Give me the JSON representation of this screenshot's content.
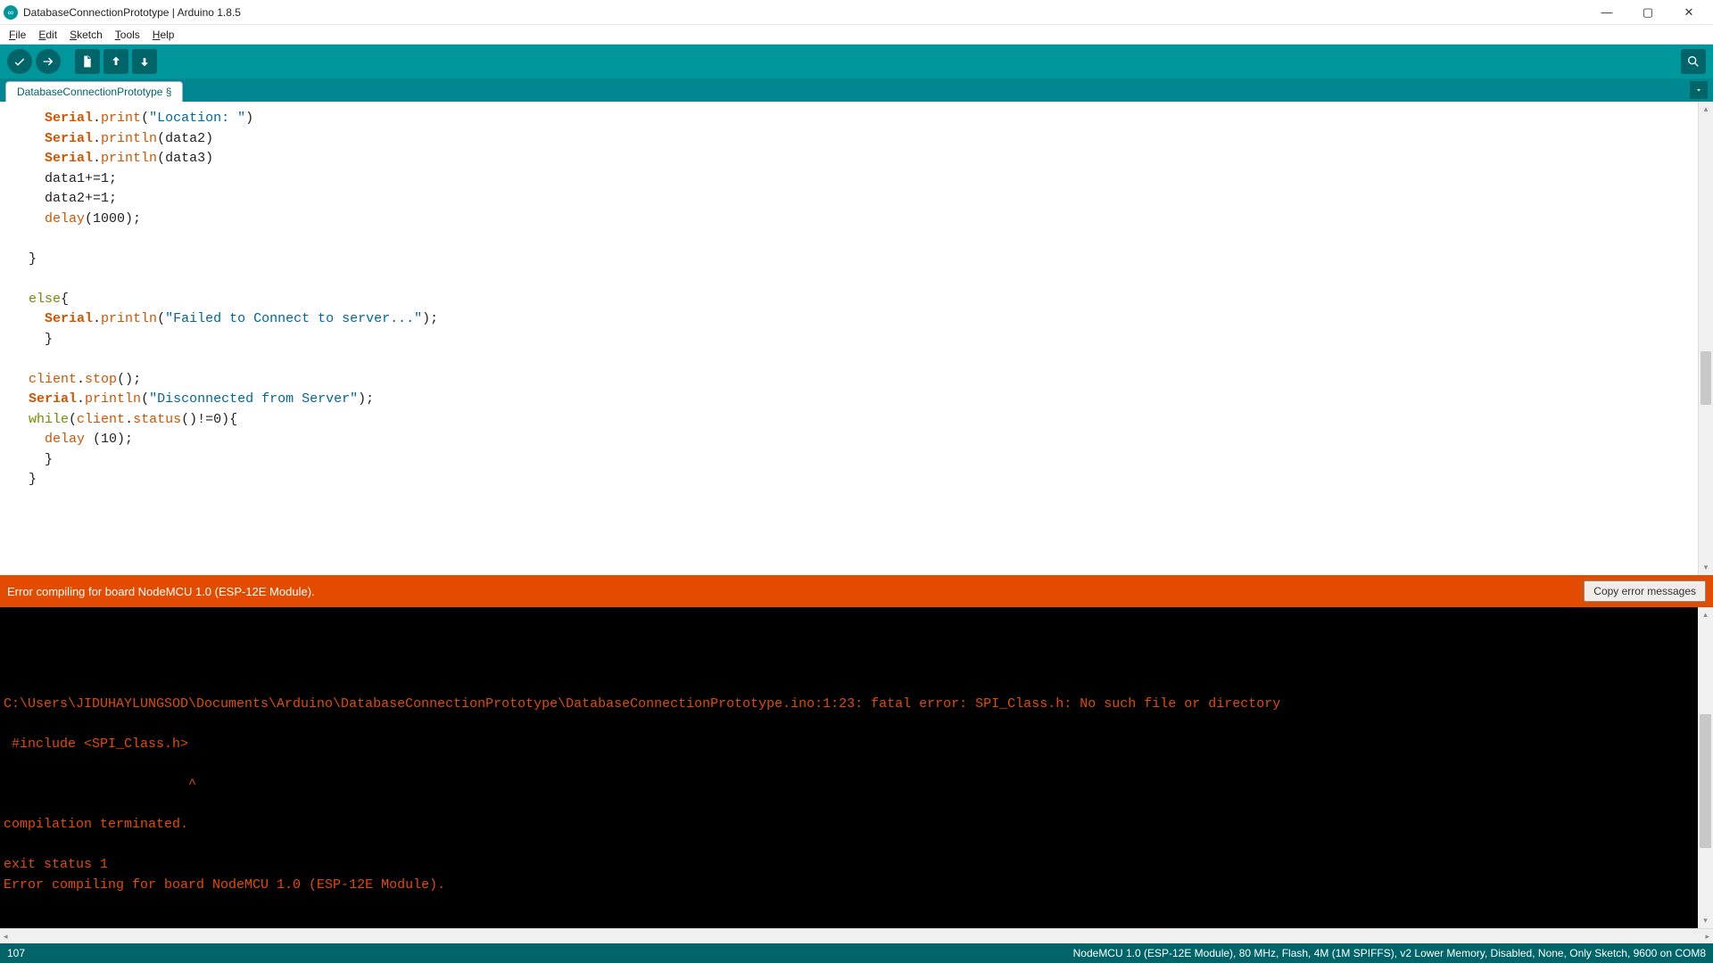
{
  "title": "DatabaseConnectionPrototype | Arduino 1.8.5",
  "app_icon_glyph": "∞",
  "menus": {
    "file": "File",
    "edit": "Edit",
    "sketch": "Sketch",
    "tools": "Tools",
    "help": "Help"
  },
  "tab": {
    "label": "DatabaseConnectionPrototype §"
  },
  "code_lines": [
    {
      "indent": 2,
      "tokens": [
        {
          "t": "Serial",
          "c": "kw-bold"
        },
        {
          "t": ".",
          "c": ""
        },
        {
          "t": "print",
          "c": "kw-orange"
        },
        {
          "t": "(",
          "c": ""
        },
        {
          "t": "\"Location: \"",
          "c": "str-blue"
        },
        {
          "t": ")",
          "c": ""
        }
      ]
    },
    {
      "indent": 2,
      "tokens": [
        {
          "t": "Serial",
          "c": "kw-bold"
        },
        {
          "t": ".",
          "c": ""
        },
        {
          "t": "println",
          "c": "kw-orange"
        },
        {
          "t": "(data2)",
          "c": ""
        }
      ]
    },
    {
      "indent": 2,
      "tokens": [
        {
          "t": "Serial",
          "c": "kw-bold"
        },
        {
          "t": ".",
          "c": ""
        },
        {
          "t": "println",
          "c": "kw-orange"
        },
        {
          "t": "(data3)",
          "c": ""
        }
      ]
    },
    {
      "indent": 2,
      "tokens": [
        {
          "t": "data1+=1;",
          "c": ""
        }
      ]
    },
    {
      "indent": 2,
      "tokens": [
        {
          "t": "data2+=1;",
          "c": ""
        }
      ]
    },
    {
      "indent": 2,
      "tokens": [
        {
          "t": "delay",
          "c": "kw-orange"
        },
        {
          "t": "(1000);",
          "c": ""
        }
      ]
    },
    {
      "indent": 0,
      "tokens": []
    },
    {
      "indent": 1,
      "tokens": [
        {
          "t": "}",
          "c": ""
        }
      ]
    },
    {
      "indent": 0,
      "tokens": []
    },
    {
      "indent": 1,
      "tokens": [
        {
          "t": "else",
          "c": "green"
        },
        {
          "t": "{",
          "c": ""
        }
      ]
    },
    {
      "indent": 2,
      "tokens": [
        {
          "t": "Serial",
          "c": "kw-bold"
        },
        {
          "t": ".",
          "c": ""
        },
        {
          "t": "println",
          "c": "kw-orange"
        },
        {
          "t": "(",
          "c": ""
        },
        {
          "t": "\"Failed to Connect to server...\"",
          "c": "str-blue"
        },
        {
          "t": ");",
          "c": ""
        }
      ]
    },
    {
      "indent": 2,
      "tokens": [
        {
          "t": "}",
          "c": ""
        }
      ]
    },
    {
      "indent": 0,
      "tokens": []
    },
    {
      "indent": 1,
      "tokens": [
        {
          "t": "client",
          "c": "kw-orange"
        },
        {
          "t": ".",
          "c": ""
        },
        {
          "t": "stop",
          "c": "kw-orange"
        },
        {
          "t": "();",
          "c": ""
        }
      ]
    },
    {
      "indent": 1,
      "tokens": [
        {
          "t": "Serial",
          "c": "kw-bold"
        },
        {
          "t": ".",
          "c": ""
        },
        {
          "t": "println",
          "c": "kw-orange"
        },
        {
          "t": "(",
          "c": ""
        },
        {
          "t": "\"Disconnected from Server\"",
          "c": "str-blue"
        },
        {
          "t": ");",
          "c": ""
        }
      ]
    },
    {
      "indent": 1,
      "tokens": [
        {
          "t": "while",
          "c": "green"
        },
        {
          "t": "(",
          "c": ""
        },
        {
          "t": "client",
          "c": "kw-orange"
        },
        {
          "t": ".",
          "c": ""
        },
        {
          "t": "status",
          "c": "kw-orange"
        },
        {
          "t": "()!=0){",
          "c": ""
        }
      ]
    },
    {
      "indent": 2,
      "tokens": [
        {
          "t": "delay",
          "c": "kw-orange"
        },
        {
          "t": " (10);",
          "c": ""
        }
      ]
    },
    {
      "indent": 2,
      "tokens": [
        {
          "t": "}",
          "c": ""
        }
      ]
    },
    {
      "indent": 1,
      "tokens": [
        {
          "t": "}",
          "c": ""
        }
      ]
    }
  ],
  "status": {
    "message": "Error compiling for board NodeMCU 1.0 (ESP-12E Module).",
    "copy_label": "Copy error messages"
  },
  "console_lines": [
    "",
    "",
    "",
    "",
    "C:\\Users\\JIDUHAYLUNGSOD\\Documents\\Arduino\\DatabaseConnectionPrototype\\DatabaseConnectionPrototype.ino:1:23: fatal error: SPI_Class.h: No such file or directory",
    "",
    " #include <SPI_Class.h>",
    "",
    "                       ^",
    "",
    "compilation terminated.",
    "",
    "exit status 1",
    "Error compiling for board NodeMCU 1.0 (ESP-12E Module)."
  ],
  "footer": {
    "line": "107",
    "board": "NodeMCU 1.0 (ESP-12E Module), 80 MHz, Flash, 4M (1M SPIFFS), v2 Lower Memory, Disabled, None, Only Sketch, 9600 on COM8"
  }
}
